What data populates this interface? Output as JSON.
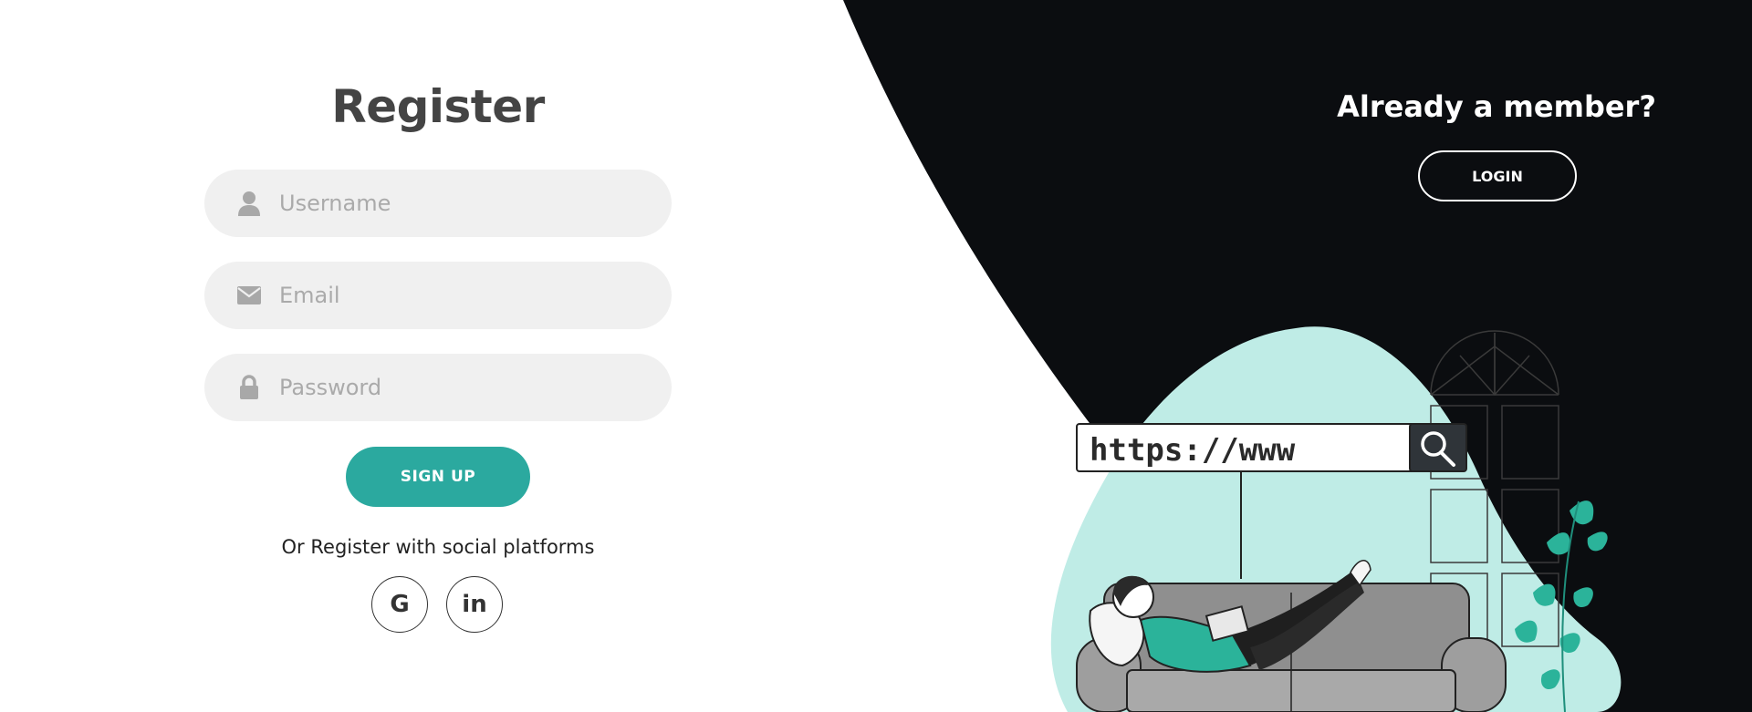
{
  "register": {
    "title": "Register",
    "username_placeholder": "Username",
    "email_placeholder": "Email",
    "password_placeholder": "Password",
    "signup_label": "SIGN UP",
    "social_text": "Or Register with social platforms",
    "social": [
      {
        "label": "G",
        "icon": "google-icon"
      },
      {
        "label": "in",
        "icon": "linkedin-icon"
      }
    ]
  },
  "panel": {
    "title": "Already a member?",
    "login_label": "LOGIN"
  },
  "illustration": {
    "search_text": "https://www"
  },
  "colors": {
    "accent": "#2ba99f",
    "panel_bg": "#0b0d10",
    "blob": "#bfece6",
    "field_bg": "#f0f0f0"
  }
}
